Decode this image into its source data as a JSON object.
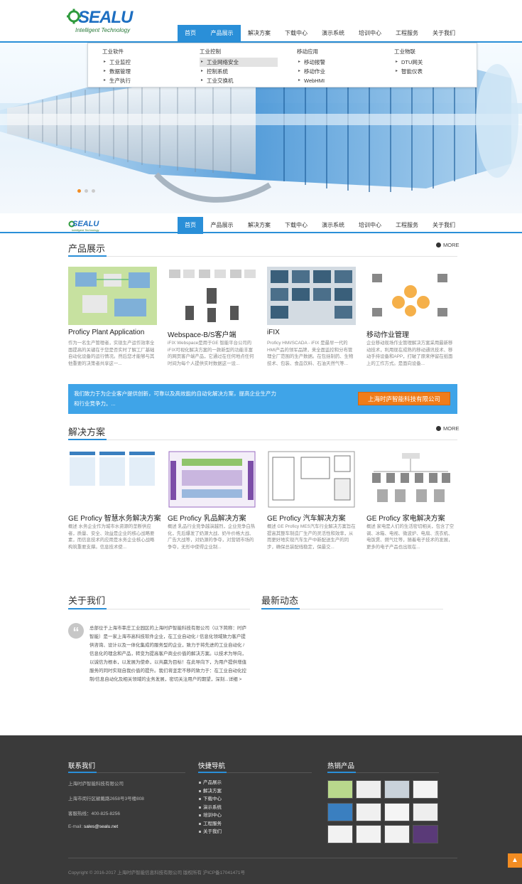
{
  "brand": {
    "logo_text": "SEALU",
    "logo_tagline": "Intelligent Technology",
    "accent": "#2a8fd8",
    "orange": "#f07c1a"
  },
  "nav": {
    "items": [
      "首页",
      "产品展示",
      "解决方案",
      "下载中心",
      "演示系统",
      "培训中心",
      "工程服务",
      "关于我们"
    ]
  },
  "mega_menu": {
    "columns": [
      {
        "heading": "工业软件",
        "items": [
          "工业监控",
          "数据管理",
          "生产执行"
        ]
      },
      {
        "heading": "工业控制",
        "items": [
          "工业网络安全",
          "控制系统",
          "工业交换机"
        ]
      },
      {
        "heading": "移动应用",
        "items": [
          "移动报警",
          "移动作业",
          "WebHMI"
        ]
      },
      {
        "heading": "工业物联",
        "items": [
          "DTU网关",
          "智能仪表"
        ]
      }
    ]
  },
  "products": {
    "title": "产品展示",
    "more": "MORE",
    "items": [
      {
        "title": "Proficy Plant Application",
        "desc": "作为一名生产管理者，实现生产运作效率全面提高的关键在于您是否实时了解工厂基础自动化设备的运行情况。然后您才能够与其他重要的决策者共享这一..."
      },
      {
        "title": "Webspace-B/S客户端",
        "desc": "iFIX Webspace是用于GE 智能平台公司的iFIX可视化解决方案的一款新型的功能丰富的网页客户端产品，它通过在任何地点任何时间为每个人提供实时数据这一设..."
      },
      {
        "title": "iFIX",
        "desc": "Proficy HMI/SCADA - iFIX 是最早一代的HMI产品的领军品牌，来全面监控和分布管理全厂范围的生产数据。在包括制药、生物技术、包装、食品饮料、石油天然气等..."
      },
      {
        "title": "移动作业管理",
        "desc": "企业移动现场作业管理解决方案采用最新移动技术，利用现在成熟的移动通讯技术、移动手持设备和APP，打破了原来停留在纸面上的工作方式。是面向设备..."
      }
    ]
  },
  "promo": {
    "text": "我们致力于为企业客户提供创新，可靠以及高效能的自动化解决方案，提高企业生产力和行业竞争力。...",
    "button": "上海时庐智能科技有限公司"
  },
  "solutions": {
    "title": "解决方案",
    "more": "MORE",
    "items": [
      {
        "title": "GE Proficy 智慧水务解决方案",
        "desc": "概述 水务企业作为城市水资源的垄断供应者，质量、安全、效益是企业的核心战略要素，而信息技术的应用是水务企业核心战略构筑重要支撑。信息技术使..."
      },
      {
        "title": "GE Proficy 乳品解决方案",
        "desc": "概述 乳品行业竞争越演越烈，企业竞争白热化，先后爆发了奶源大战、奶牛价格大战、广告大战等，对奶源的争夺，对营销市场的争夺，无形中使得企业制..."
      },
      {
        "title": "GE Proficy 汽车解决方案",
        "desc": "概述 GE Proficy MES汽车行业解决方案旨在提高其整车制造厂生产的灵活性和效率，从而更好地实现汽车生产中新配送生产的同步，确保总装配线稳定，保最交..."
      },
      {
        "title": "GE Proficy 家电解决方案",
        "desc": "概述 家电是人们的生活密切相关，包含了空调、冰箱、电视、微波炉、电扇、洗衣机、电饭煲、燃气灶等，随着电子技术的发展，更多的电子产品也出现在..."
      }
    ]
  },
  "about": {
    "title": "关于我们",
    "text": "总部位于上海市莘庄工业园区的上海时庐智能科技有限公司（以下简称：时庐智能）是一家上海市高科技软件企业，在工业自动化 / 信息化领域致力客户提供咨询、设计以及一体化集成的服务型的企业，致力于将先进的工业自动化 / 信息化的理念和产品，转变为提高客户商业价值的解决方案。以技术为导向，以诚信为根本，以发展为使命，以共赢为目标！在此导向下，为用户提供增值服务的同时实现自我价值的提升。我们将坚定不移的致力于：在工业自动化控制/信息自动化及相关领域的业务发展，密切关注用户的期望，深刻...详细 >"
  },
  "news": {
    "title": "最新动态"
  },
  "footer": {
    "contact": {
      "title": "联系我们",
      "company": "上海时庐智能科技有限公司",
      "address": "上海市闵行区颛戴路2658号3号楼808",
      "hotline": "客服热线：400-825-8256",
      "email_label": "E-mail:",
      "email": "sales@sealu.net"
    },
    "quick": {
      "title": "快捷导航",
      "links": [
        "产品展示",
        "解决方案",
        "下载中心",
        "演示系统",
        "培训中心",
        "工程服务",
        "关于我们"
      ]
    },
    "hot": {
      "title": "热销产品"
    },
    "copyright": "Copyright © 2016-2017 上海时庐智能信息科技有限公司 版权所有 沪ICP备17041471号"
  }
}
